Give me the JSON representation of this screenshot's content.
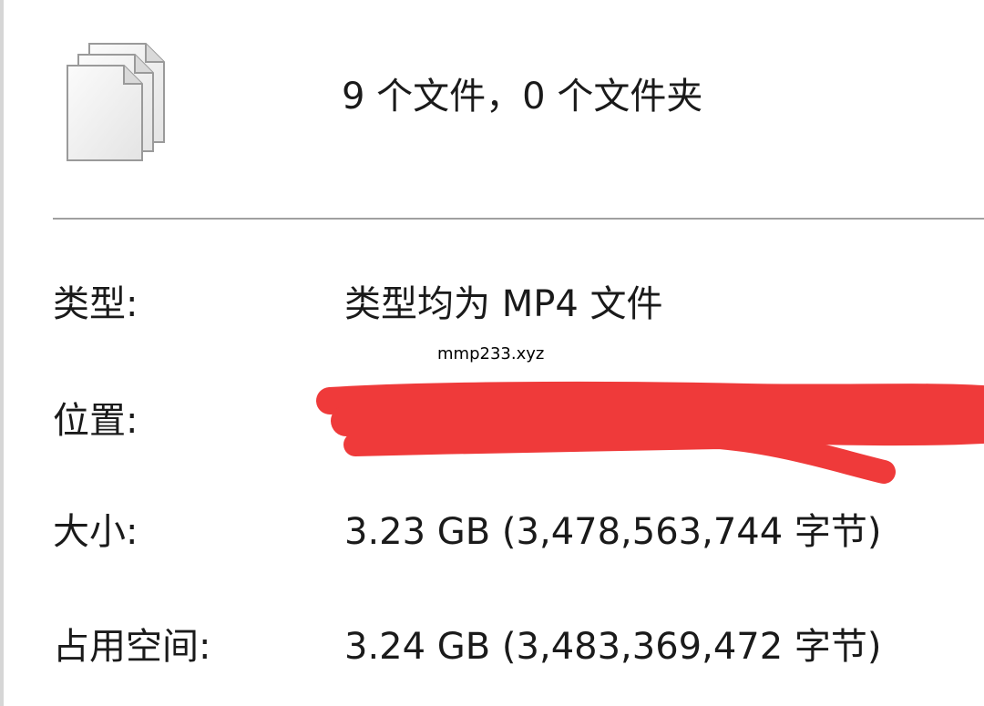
{
  "summary": "9 个文件，0 个文件夹",
  "icons": {
    "files": "multiple-files-icon"
  },
  "watermark": "mmp233.xyz",
  "rows": {
    "type": {
      "label": "类型:",
      "value": "类型均为 MP4 文件"
    },
    "location": {
      "label": "位置:",
      "value": ""
    },
    "size": {
      "label": "大小:",
      "value": "3.23 GB (3,478,563,744 字节)"
    },
    "on_disk": {
      "label": "占用空间:",
      "value": "3.24 GB (3,483,369,472 字节)"
    }
  },
  "colors": {
    "redaction": "#ef3a3a",
    "divider": "#a0a0a0",
    "text": "#1a1a1a"
  }
}
